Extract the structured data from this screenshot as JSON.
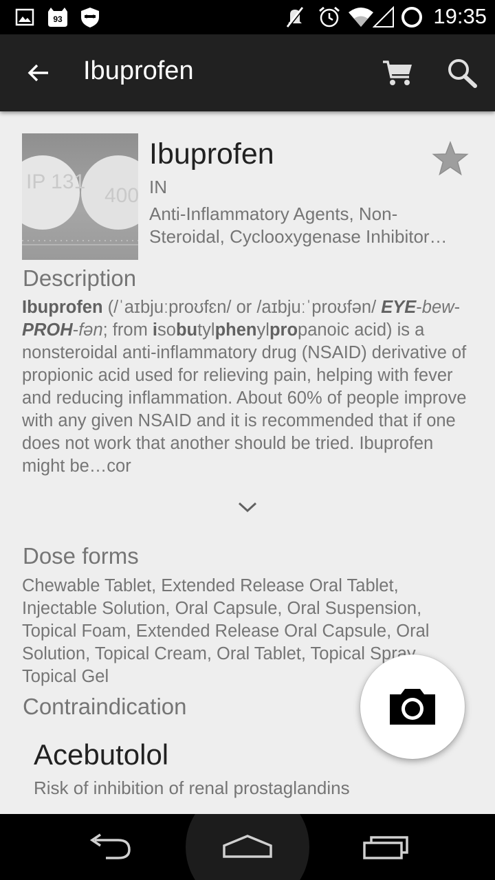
{
  "status_bar": {
    "time": "19:35",
    "notification_badge": "93",
    "icons": [
      "image-icon",
      "notification-app-icon",
      "incognito-icon",
      "mute-icon",
      "alarm-icon",
      "wifi-icon",
      "signal-icon",
      "sync-icon"
    ]
  },
  "action_bar": {
    "title": "Ibuprofen",
    "icons": [
      "back-arrow-icon",
      "cart-icon",
      "search-icon"
    ]
  },
  "drug": {
    "name": "Ibuprofen",
    "code": "IN",
    "classification": "Anti-Inflammatory Agents, Non-Steroidal, Cyclooxygenase Inhibitor…",
    "image_imprint_left": "IP 131",
    "image_imprint_right": "400"
  },
  "description": {
    "heading": "Description",
    "parts": [
      "Ibuprofen",
      " (/ˈaɪbjuːproʊfɛn/ or /aɪbjuːˈproʊfən/ ",
      "EYE",
      "-",
      "bew",
      "-",
      "PROH",
      "-",
      "fən",
      "; from ",
      "i",
      "so",
      "bu",
      "tyl",
      "phen",
      "yl",
      "pro",
      "panoic acid) is a nonsteroidal anti-inflammatory drug (NSAID) derivative of propionic acid used for relieving pain, helping with fever and reducing inflammation. About 60% of people improve with any given NSAID and it is recommended that if one does not work that another should be tried. Ibuprofen might be…cor"
    ]
  },
  "dose_forms": {
    "heading": "Dose forms",
    "text": "Chewable Tablet, Extended Release Oral Tablet, Injectable Solution, Oral Capsule, Oral Suspension, Topical Foam, Extended Release Oral Capsule, Oral Solution, Topical Cream, Oral Tablet, Topical Spray, Topical Gel"
  },
  "contraindication": {
    "heading": "Contraindication",
    "items": [
      {
        "name": "Acebutolol",
        "reason": "Risk of inhibition of renal prostaglandins"
      }
    ]
  },
  "colors": {
    "action_bar": "#212121",
    "background": "#eeeeee",
    "secondary_text": "#757575",
    "star": "#9e9e9e"
  }
}
